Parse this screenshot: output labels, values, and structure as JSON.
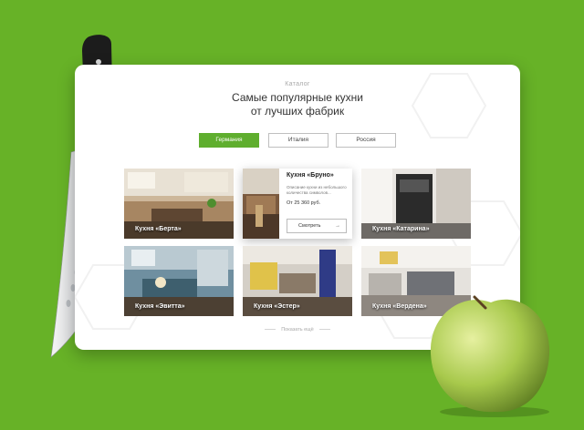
{
  "header": {
    "eyebrow": "Каталог",
    "title_line1": "Самые популярные кухни",
    "title_line2": "от лучших фабрик"
  },
  "tabs": [
    {
      "label": "Германия",
      "active": true
    },
    {
      "label": "Италия",
      "active": false
    },
    {
      "label": "Россия",
      "active": false
    }
  ],
  "kitchens": [
    {
      "label": "Кухня «Берта»"
    },
    {
      "label": "Кухня «Бруно»",
      "description": "Описание кухни из небольшого количества символов...",
      "price": "От 25 360 руб.",
      "button": "Смотреть",
      "arrow": "→"
    },
    {
      "label": "Кухня «Катарина»"
    },
    {
      "label": "Кухня «Эвитта»"
    },
    {
      "label": "Кухня «Эстер»"
    },
    {
      "label": "Кухня «Вердена»"
    }
  ],
  "show_more": "Показать ещё",
  "colors": {
    "background": "#67b227",
    "accent": "#5fae2e",
    "card": "#ffffff"
  }
}
